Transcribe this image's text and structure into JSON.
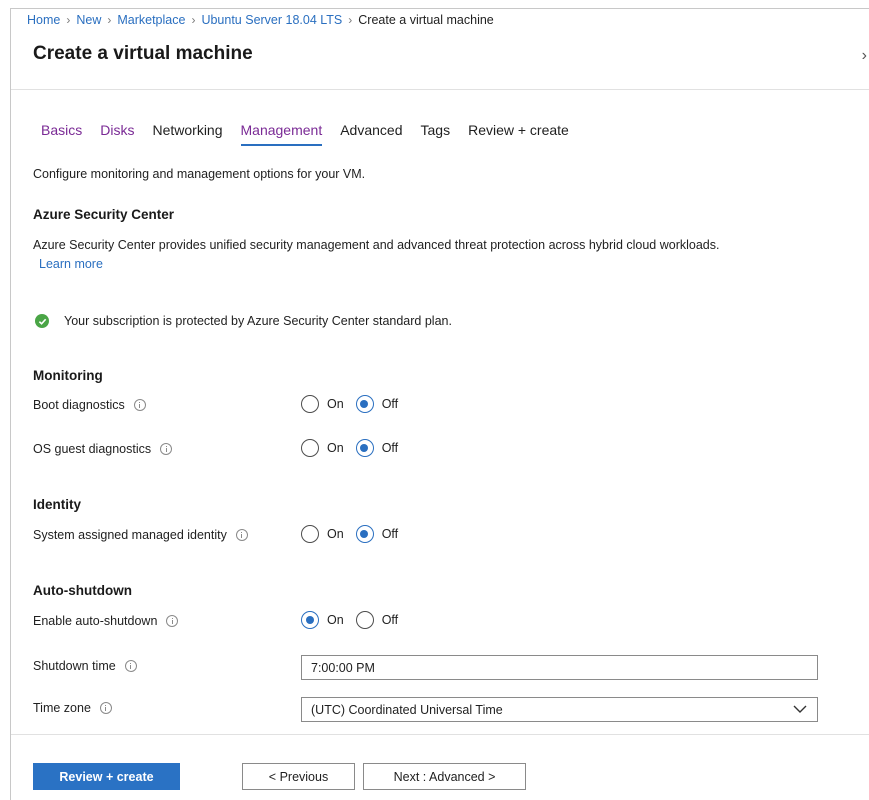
{
  "breadcrumb": [
    "Home",
    "New",
    "Marketplace",
    "Ubuntu Server 18.04 LTS",
    "Create a virtual machine"
  ],
  "page": {
    "title": "Create a virtual machine"
  },
  "tabs": [
    {
      "label": "Basics",
      "state": "visited"
    },
    {
      "label": "Disks",
      "state": "visited"
    },
    {
      "label": "Networking",
      "state": "default"
    },
    {
      "label": "Management",
      "state": "active"
    },
    {
      "label": "Advanced",
      "state": "default"
    },
    {
      "label": "Tags",
      "state": "default"
    },
    {
      "label": "Review + create",
      "state": "default"
    }
  ],
  "intro": "Configure monitoring and management options for your VM.",
  "security_center": {
    "heading": "Azure Security Center",
    "description": "Azure Security Center provides unified security management and advanced threat protection across hybrid cloud workloads.",
    "learn_more": "Learn more",
    "status": "Your subscription is protected by Azure Security Center standard plan."
  },
  "monitoring": {
    "heading": "Monitoring",
    "boot_diagnostics": {
      "label": "Boot diagnostics",
      "value": "Off"
    },
    "os_guest_diagnostics": {
      "label": "OS guest diagnostics",
      "value": "Off"
    }
  },
  "identity": {
    "heading": "Identity",
    "managed_identity": {
      "label": "System assigned managed identity",
      "value": "Off"
    }
  },
  "auto_shutdown": {
    "heading": "Auto-shutdown",
    "enable": {
      "label": "Enable auto-shutdown",
      "value": "On"
    },
    "shutdown_time": {
      "label": "Shutdown time",
      "value": "7:00:00 PM"
    },
    "time_zone": {
      "label": "Time zone",
      "value": "(UTC) Coordinated Universal Time"
    }
  },
  "radio_labels": {
    "on": "On",
    "off": "Off"
  },
  "footer": {
    "review_create": "Review + create",
    "previous": "< Previous",
    "next": "Next : Advanced >"
  },
  "colors": {
    "link": "#2a6fc0",
    "visited_tab": "#7a2a95",
    "primary_button": "#2a72c4",
    "success": "#4aa546"
  }
}
